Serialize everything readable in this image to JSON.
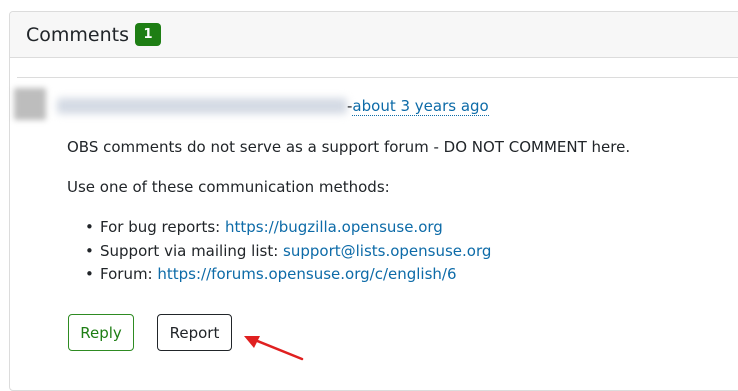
{
  "card": {
    "title": "Comments",
    "count": "1"
  },
  "comment": {
    "time_separator": "-",
    "time_ago": "about 3 years ago",
    "paragraph1": "OBS comments do not serve as a support forum - DO NOT COMMENT here.",
    "paragraph2": "Use one of these communication methods:",
    "methods": [
      {
        "label": "For bug reports: ",
        "link": "https://bugzilla.opensuse.org"
      },
      {
        "label": "Support via mailing list: ",
        "link": "support@lists.opensuse.org"
      },
      {
        "label": "Forum: ",
        "link": "https://forums.opensuse.org/c/english/6"
      }
    ]
  },
  "actions": {
    "reply_label": "Reply",
    "report_label": "Report"
  },
  "colors": {
    "badge": "#1e7e14",
    "link": "#0d6ba8",
    "annotation_arrow": "#e02020"
  }
}
